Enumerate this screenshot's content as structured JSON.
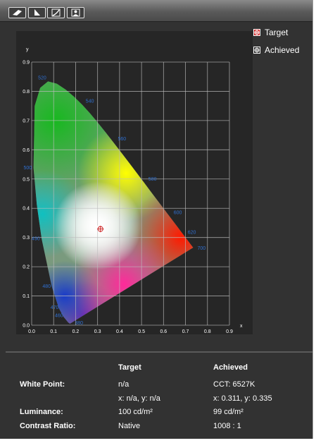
{
  "toolbar": {
    "buttons": [
      {
        "icon": "eraser-icon"
      },
      {
        "icon": "wedge-icon"
      },
      {
        "icon": "curve-icon"
      },
      {
        "icon": "person-icon"
      }
    ]
  },
  "legend": {
    "target_label": "Target",
    "achieved_label": "Achieved"
  },
  "chart_data": {
    "type": "scatter",
    "subtype": "cie-1931-chromaticity",
    "xlabel": "x",
    "ylabel": "y",
    "xlim": [
      0.0,
      0.9
    ],
    "ylim": [
      0.0,
      0.9
    ],
    "x_ticks": [
      "0.0",
      "0.1",
      "0.2",
      "0.3",
      "0.4",
      "0.5",
      "0.6",
      "0.7",
      "0.8",
      "0.9"
    ],
    "y_ticks": [
      "0.0",
      "0.1",
      "0.2",
      "0.3",
      "0.4",
      "0.5",
      "0.6",
      "0.7",
      "0.8",
      "0.9"
    ],
    "grid": true,
    "wavelength_labels": [
      {
        "text": "380",
        "x": 0.174,
        "y": 0.005
      },
      {
        "text": "460",
        "x": 0.144,
        "y": 0.03
      },
      {
        "text": "470",
        "x": 0.124,
        "y": 0.058
      },
      {
        "text": "480",
        "x": 0.091,
        "y": 0.133
      },
      {
        "text": "490",
        "x": 0.045,
        "y": 0.295
      },
      {
        "text": "500",
        "x": 0.008,
        "y": 0.538
      },
      {
        "text": "520",
        "x": 0.074,
        "y": 0.834
      },
      {
        "text": "540",
        "x": 0.23,
        "y": 0.754
      },
      {
        "text": "560",
        "x": 0.373,
        "y": 0.625
      },
      {
        "text": "580",
        "x": 0.512,
        "y": 0.487
      },
      {
        "text": "600",
        "x": 0.627,
        "y": 0.373
      },
      {
        "text": "620",
        "x": 0.691,
        "y": 0.308
      },
      {
        "text": "700",
        "x": 0.735,
        "y": 0.265
      }
    ],
    "points": [
      {
        "name": "Achieved",
        "x": 0.311,
        "y": 0.335
      },
      {
        "name": "Target",
        "x": 0.313,
        "y": 0.329
      }
    ]
  },
  "table": {
    "col_target": "Target",
    "col_achieved": "Achieved",
    "rows": [
      {
        "label": "White Point:",
        "target": "n/a",
        "achieved": "CCT: 6527K"
      },
      {
        "label": "",
        "target": "x: n/a, y: n/a",
        "achieved": "x: 0.311, y: 0.335"
      },
      {
        "label": "Luminance:",
        "target": "100 cd/m²",
        "achieved": "99 cd/m²"
      },
      {
        "label": "Contrast Ratio:",
        "target": "Native",
        "achieved": "1008 : 1"
      }
    ]
  },
  "colors": {
    "wavelength_label": "#2f6fd0",
    "target_marker": "#cc2222",
    "achieved_marker": "#ffffff"
  }
}
